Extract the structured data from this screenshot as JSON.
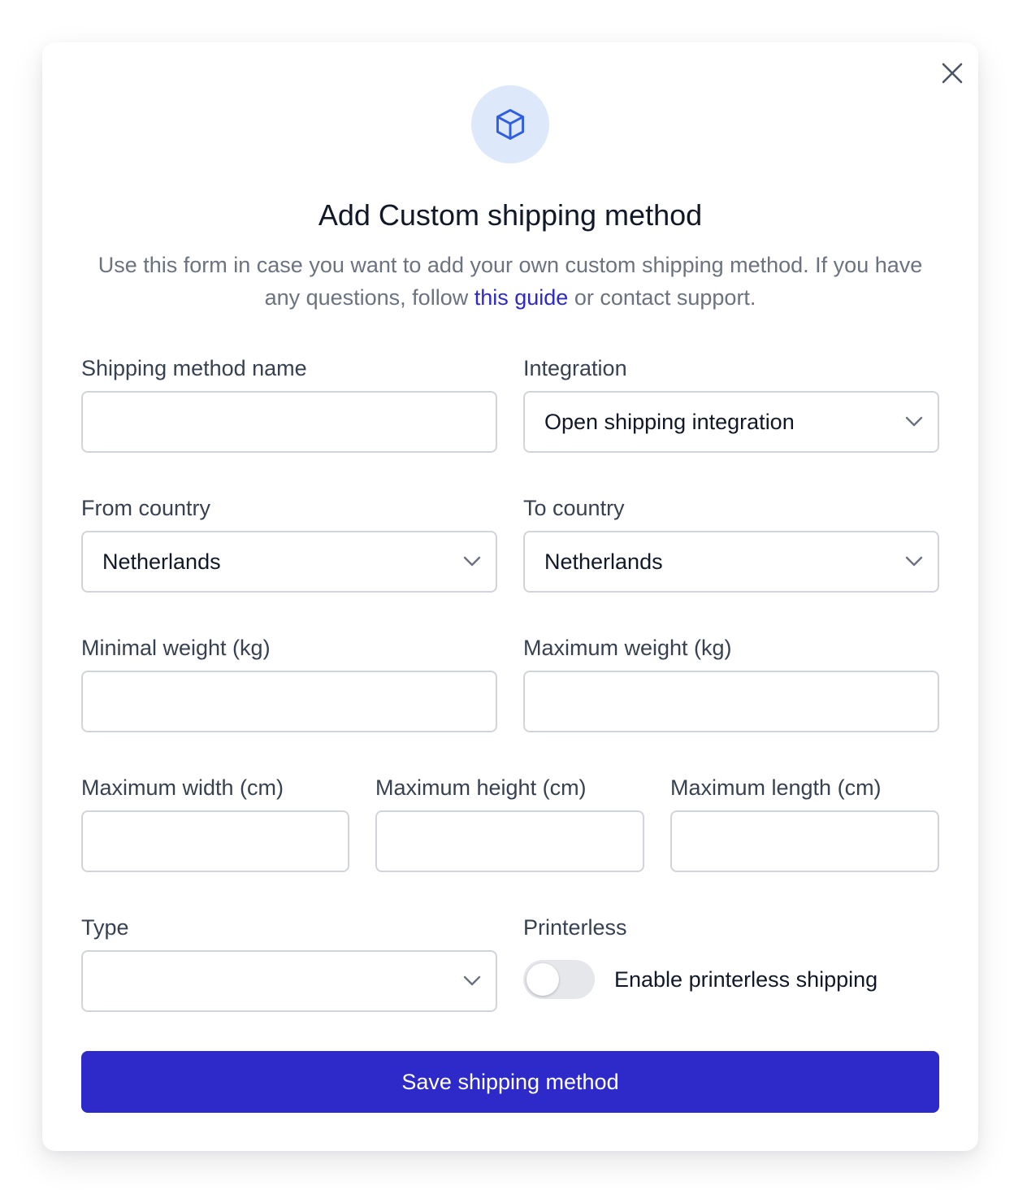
{
  "modal": {
    "title": "Add Custom shipping method",
    "description_before": "Use this form in case you want to add your own custom shipping method. If you have any questions, follow ",
    "guide_link": "this guide",
    "description_after": " or contact support.",
    "header_icon": "box-icon",
    "close_icon": "close-icon"
  },
  "form": {
    "shipping_method_name": {
      "label": "Shipping method name",
      "value": ""
    },
    "integration": {
      "label": "Integration",
      "value": "Open shipping integration"
    },
    "from_country": {
      "label": "From country",
      "value": "Netherlands"
    },
    "to_country": {
      "label": "To country",
      "value": "Netherlands"
    },
    "min_weight": {
      "label": "Minimal weight (kg)",
      "value": ""
    },
    "max_weight": {
      "label": "Maximum weight (kg)",
      "value": ""
    },
    "max_width": {
      "label": "Maximum width (cm)",
      "value": ""
    },
    "max_height": {
      "label": "Maximum height (cm)",
      "value": ""
    },
    "max_length": {
      "label": "Maximum length (cm)",
      "value": ""
    },
    "type": {
      "label": "Type",
      "value": ""
    },
    "printerless": {
      "label": "Printerless",
      "toggle_label": "Enable printerless shipping",
      "enabled": false
    }
  },
  "actions": {
    "save_label": "Save shipping method"
  },
  "colors": {
    "primary": "#2d2ac9",
    "icon_bg": "#dde8fb",
    "icon_stroke": "#2f5fe0"
  }
}
